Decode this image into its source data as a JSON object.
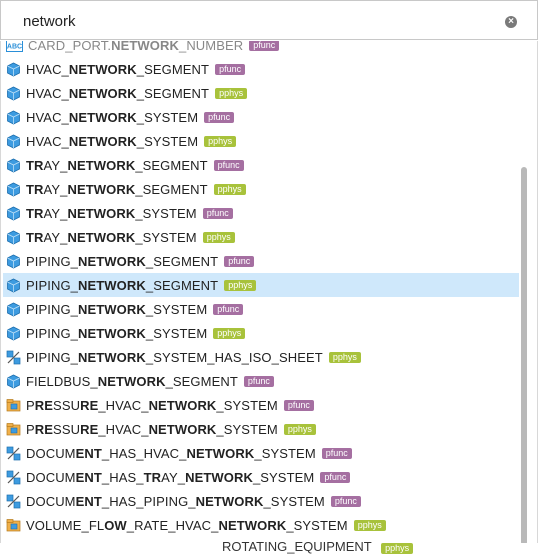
{
  "search": {
    "value": "network",
    "placeholder": ""
  },
  "items": [
    {
      "segments": [
        {
          "t": "CARD_PORT.",
          "b": false
        },
        {
          "t": "NETWORK",
          "b": true
        },
        {
          "t": "_NUMBER",
          "b": false
        }
      ],
      "badge": "pfunc",
      "icon": "text-attribute-icon",
      "selected": false,
      "faded": true
    },
    {
      "segments": [
        {
          "t": "HVAC_",
          "b": false
        },
        {
          "t": "NETWORK",
          "b": true
        },
        {
          "t": "_SEGMENT",
          "b": false
        }
      ],
      "badge": "pfunc",
      "icon": "cube-icon",
      "selected": false
    },
    {
      "segments": [
        {
          "t": "HVAC_",
          "b": false
        },
        {
          "t": "NETWORK",
          "b": true
        },
        {
          "t": "_SEGMENT",
          "b": false
        }
      ],
      "badge": "pphys",
      "icon": "cube-icon",
      "selected": false
    },
    {
      "segments": [
        {
          "t": "HVAC_",
          "b": false
        },
        {
          "t": "NETWORK",
          "b": true
        },
        {
          "t": "_SYSTEM",
          "b": false
        }
      ],
      "badge": "pfunc",
      "icon": "cube-icon",
      "selected": false
    },
    {
      "segments": [
        {
          "t": "HVAC_",
          "b": false
        },
        {
          "t": "NETWORK",
          "b": true
        },
        {
          "t": "_SYSTEM",
          "b": false
        }
      ],
      "badge": "pphys",
      "icon": "cube-icon",
      "selected": false
    },
    {
      "segments": [
        {
          "t": "TR",
          "b": true
        },
        {
          "t": "AY_",
          "b": false
        },
        {
          "t": "NETWORK",
          "b": true
        },
        {
          "t": "_SEGMENT",
          "b": false
        }
      ],
      "badge": "pfunc",
      "icon": "cube-icon",
      "selected": false
    },
    {
      "segments": [
        {
          "t": "TR",
          "b": true
        },
        {
          "t": "AY_",
          "b": false
        },
        {
          "t": "NETWORK",
          "b": true
        },
        {
          "t": "_SEGMENT",
          "b": false
        }
      ],
      "badge": "pphys",
      "icon": "cube-icon",
      "selected": false
    },
    {
      "segments": [
        {
          "t": "TR",
          "b": true
        },
        {
          "t": "AY_",
          "b": false
        },
        {
          "t": "NETWORK",
          "b": true
        },
        {
          "t": "_SYSTEM",
          "b": false
        }
      ],
      "badge": "pfunc",
      "icon": "cube-icon",
      "selected": false
    },
    {
      "segments": [
        {
          "t": "TR",
          "b": true
        },
        {
          "t": "AY_",
          "b": false
        },
        {
          "t": "NETWORK",
          "b": true
        },
        {
          "t": "_SYSTEM",
          "b": false
        }
      ],
      "badge": "pphys",
      "icon": "cube-icon",
      "selected": false
    },
    {
      "segments": [
        {
          "t": "PIPING_",
          "b": false
        },
        {
          "t": "NETWORK",
          "b": true
        },
        {
          "t": "_SEGMENT",
          "b": false
        }
      ],
      "badge": "pfunc",
      "icon": "cube-icon",
      "selected": false
    },
    {
      "segments": [
        {
          "t": "PIPING_",
          "b": false
        },
        {
          "t": "NETWORK",
          "b": true
        },
        {
          "t": "_SEGMENT",
          "b": false
        }
      ],
      "badge": "pphys",
      "icon": "cube-icon",
      "selected": true
    },
    {
      "segments": [
        {
          "t": "PIPING_",
          "b": false
        },
        {
          "t": "NETWORK",
          "b": true
        },
        {
          "t": "_SYSTEM",
          "b": false
        }
      ],
      "badge": "pfunc",
      "icon": "cube-icon",
      "selected": false
    },
    {
      "segments": [
        {
          "t": "PIPING_",
          "b": false
        },
        {
          "t": "NETWORK",
          "b": true
        },
        {
          "t": "_SYSTEM",
          "b": false
        }
      ],
      "badge": "pphys",
      "icon": "cube-icon",
      "selected": false
    },
    {
      "segments": [
        {
          "t": "PIPING_",
          "b": false
        },
        {
          "t": "NETWORK",
          "b": true
        },
        {
          "t": "_SYSTEM_HAS_ISO_SHEET",
          "b": false
        }
      ],
      "badge": "pphys",
      "icon": "relation-icon",
      "selected": false
    },
    {
      "segments": [
        {
          "t": "FIELDBUS_",
          "b": false
        },
        {
          "t": "NETWORK",
          "b": true
        },
        {
          "t": "_SEGMENT",
          "b": false
        }
      ],
      "badge": "pfunc",
      "icon": "cube-icon",
      "selected": false
    },
    {
      "segments": [
        {
          "t": "P",
          "b": false
        },
        {
          "t": "RE",
          "b": true
        },
        {
          "t": "SSU",
          "b": false
        },
        {
          "t": "RE",
          "b": true
        },
        {
          "t": "_HVAC_",
          "b": false
        },
        {
          "t": "NETWORK",
          "b": true
        },
        {
          "t": "_SYSTEM",
          "b": false
        }
      ],
      "badge": "pfunc",
      "icon": "folder-cube-icon",
      "selected": false
    },
    {
      "segments": [
        {
          "t": "P",
          "b": false
        },
        {
          "t": "RE",
          "b": true
        },
        {
          "t": "SSU",
          "b": false
        },
        {
          "t": "RE",
          "b": true
        },
        {
          "t": "_HVAC_",
          "b": false
        },
        {
          "t": "NETWORK",
          "b": true
        },
        {
          "t": "_SYSTEM",
          "b": false
        }
      ],
      "badge": "pphys",
      "icon": "folder-cube-icon",
      "selected": false
    },
    {
      "segments": [
        {
          "t": "DOCUM",
          "b": false
        },
        {
          "t": "ENT",
          "b": true
        },
        {
          "t": "_HAS_HVAC_",
          "b": false
        },
        {
          "t": "NETWORK",
          "b": true
        },
        {
          "t": "_SYSTEM",
          "b": false
        }
      ],
      "badge": "pfunc",
      "icon": "relation-icon",
      "selected": false
    },
    {
      "segments": [
        {
          "t": "DOCUM",
          "b": false
        },
        {
          "t": "ENT",
          "b": true
        },
        {
          "t": "_HAS_",
          "b": false
        },
        {
          "t": "TR",
          "b": true
        },
        {
          "t": "AY_",
          "b": false
        },
        {
          "t": "NETWORK",
          "b": true
        },
        {
          "t": "_SYSTEM",
          "b": false
        }
      ],
      "badge": "pfunc",
      "icon": "relation-icon",
      "selected": false
    },
    {
      "segments": [
        {
          "t": "DOCUM",
          "b": false
        },
        {
          "t": "ENT",
          "b": true
        },
        {
          "t": "_HAS_PIPING_",
          "b": false
        },
        {
          "t": "NETWORK",
          "b": true
        },
        {
          "t": "_SYSTEM",
          "b": false
        }
      ],
      "badge": "pfunc",
      "icon": "relation-icon",
      "selected": false
    },
    {
      "segments": [
        {
          "t": "VOLUME_FL",
          "b": false
        },
        {
          "t": "OW",
          "b": true
        },
        {
          "t": "_RATE_HVAC_",
          "b": false
        },
        {
          "t": "NETWORK",
          "b": true
        },
        {
          "t": "_SYSTEM",
          "b": false
        }
      ],
      "badge": "pphys",
      "icon": "folder-cube-icon",
      "selected": false
    }
  ],
  "bottom_peek": {
    "label": "ROTATING_EQUIPMENT",
    "badge": "pphys"
  },
  "colors": {
    "pfunc": "#a56fa1",
    "pphys": "#a8c23b",
    "selection": "#cfe8fb",
    "cube": "#2a8fd8"
  }
}
